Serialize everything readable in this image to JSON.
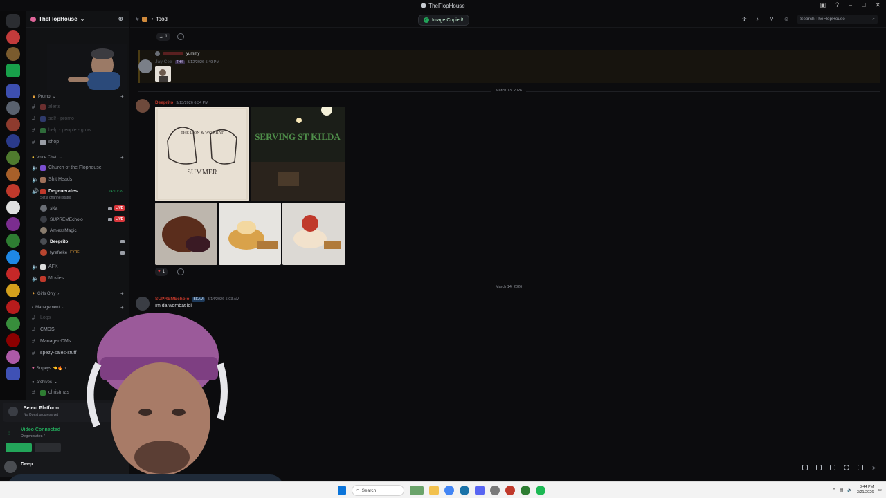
{
  "window": {
    "title": "TheFlopHouse"
  },
  "server": {
    "name": "TheFlopHouse"
  },
  "channel": {
    "name": "food",
    "header_prefix": "•"
  },
  "search": {
    "placeholder": "Search TheFlopHouse"
  },
  "toast": {
    "text": "Image Copied!"
  },
  "sidebar": {
    "categories": [
      {
        "label": "Promo"
      },
      {
        "label": "Voice Chat"
      },
      {
        "label": "Girls Only"
      },
      {
        "label": "Management"
      },
      {
        "label": "Snipeys 👈🔥"
      },
      {
        "label": "archives"
      }
    ],
    "channels": [
      {
        "label": "alerts"
      },
      {
        "label": "self - promo"
      },
      {
        "label": "help - people - grow"
      },
      {
        "label": "shop"
      },
      {
        "label": "Church of the Flophouse"
      },
      {
        "label": "Shit Heads"
      },
      {
        "label": "Degenerates"
      },
      {
        "label": "AFK"
      },
      {
        "label": "Movies"
      },
      {
        "label": "Logs"
      },
      {
        "label": "CMDS"
      },
      {
        "label": "Manager-DMs"
      },
      {
        "label": "spezy-sales-stuff"
      },
      {
        "label": "christmas"
      }
    ],
    "degenerates_timer": "24:10:39",
    "channel_status": "Set a channel status",
    "voice_users": [
      {
        "name": "sKa",
        "live": "LIVE"
      },
      {
        "name": "SUPREMEcholo",
        "live": "LIVE"
      },
      {
        "name": "AmiessMagic"
      },
      {
        "name": "Deeprito"
      },
      {
        "name": "fyrefreke",
        "tag": "FYRE"
      }
    ]
  },
  "user_panel": {
    "platform": "Select Platform",
    "platform_sub": "No Quest progress yet",
    "voice_status": "Video Connected",
    "voice_channel": "Degenerates /",
    "username": "Deep"
  },
  "messages": [
    {
      "reply_text": "yummy",
      "author": "Jay Cee",
      "tag": "THX",
      "time": "3/12/2026 5:49 PM"
    },
    {
      "author": "Deeprito",
      "time": "3/13/2026 6:34 PM",
      "reaction_count": "1"
    },
    {
      "author": "SUPREMEcholo",
      "tag": "BEAM",
      "time": "3/14/2026 5:03 AM",
      "text": "Im da wombat lol"
    }
  ],
  "top_reaction_count": "1",
  "dates": [
    "March 13, 2026",
    "March 14, 2026"
  ],
  "image_texts": {
    "lion": "THE LION & WOMBAT",
    "summer": "SUMMER",
    "neon": "SERVING ST KILDA"
  },
  "taskbar": {
    "search": "Search",
    "time": "8:44 PM",
    "date": "3/21/2026"
  },
  "colors": {
    "accent": "#5865f2",
    "live": "#da373c",
    "online": "#23a55a",
    "author_red": "#f23f43"
  }
}
